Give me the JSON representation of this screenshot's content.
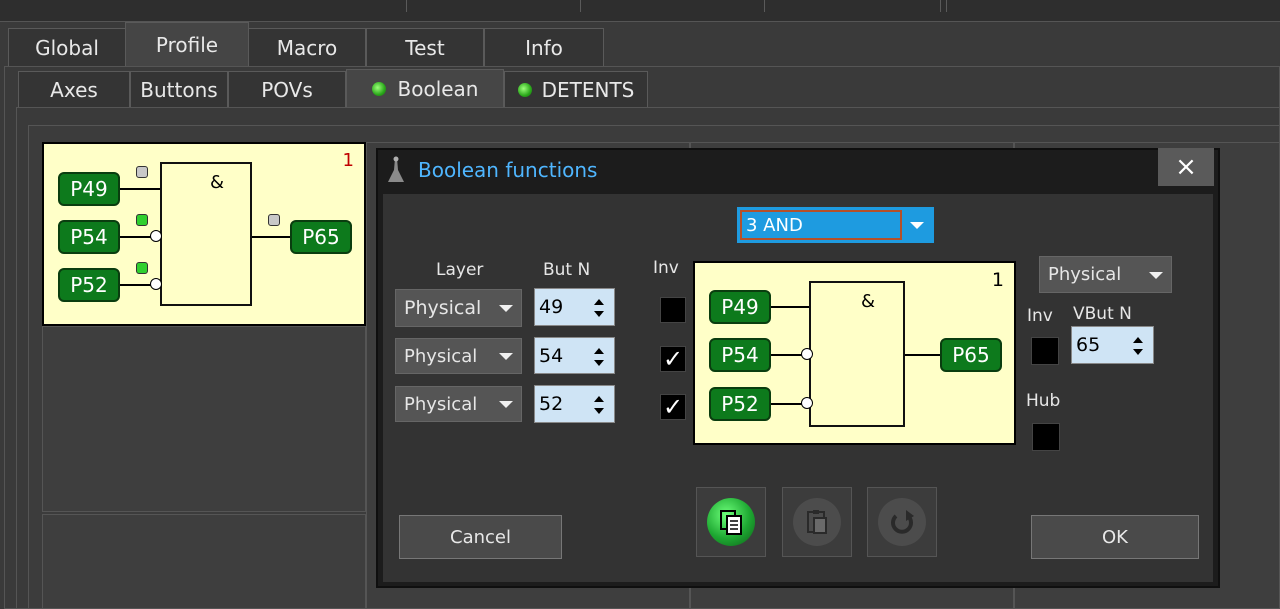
{
  "main_tabs": [
    "Global",
    "Profile",
    "Macro",
    "Test",
    "Info"
  ],
  "sub_tabs": [
    "Axes",
    "Buttons",
    "POVs",
    "Boolean",
    "DETENTS"
  ],
  "mini_gate": {
    "number": "1",
    "symbol": "&",
    "inputs": [
      "P49",
      "P54",
      "P52"
    ],
    "output": "P65"
  },
  "dialog": {
    "title": "Boolean functions",
    "close": "×",
    "function_select": "3 AND",
    "col_layer": "Layer",
    "col_butn": "But N",
    "col_inv": "Inv",
    "rows": [
      {
        "layer": "Physical",
        "but": "49",
        "inv": ""
      },
      {
        "layer": "Physical",
        "but": "54",
        "inv": "✓"
      },
      {
        "layer": "Physical",
        "but": "52",
        "inv": "✓"
      }
    ],
    "gate": {
      "number": "1",
      "symbol": "&",
      "inputs": [
        "P49",
        "P54",
        "P52"
      ],
      "output": "P65"
    },
    "out_layer": "Physical",
    "out_inv_label": "Inv",
    "vbut_label": "VBut N",
    "vbut_value": "65",
    "hub_label": "Hub",
    "cancel": "Cancel",
    "ok": "OK"
  },
  "colors": {
    "accent": "#1e9be0",
    "title_text": "#4fb6ff",
    "green_box": "#0d7a1c",
    "led_green": "#2fcf2f"
  }
}
